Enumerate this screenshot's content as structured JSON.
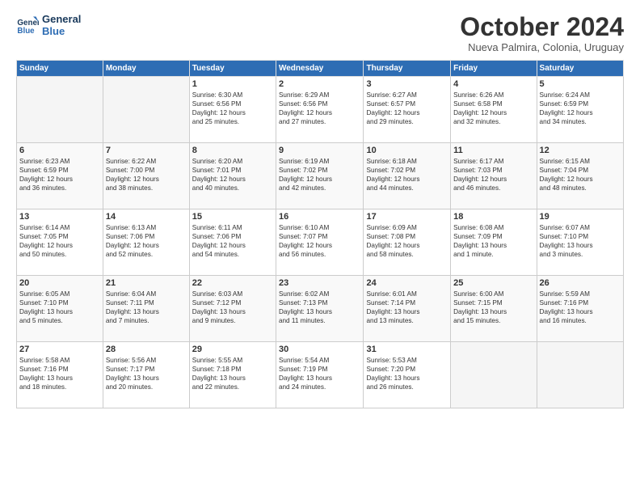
{
  "logo": {
    "line1": "General",
    "line2": "Blue"
  },
  "title": "October 2024",
  "subtitle": "Nueva Palmira, Colonia, Uruguay",
  "days_header": [
    "Sunday",
    "Monday",
    "Tuesday",
    "Wednesday",
    "Thursday",
    "Friday",
    "Saturday"
  ],
  "weeks": [
    [
      {
        "day": "",
        "info": ""
      },
      {
        "day": "",
        "info": ""
      },
      {
        "day": "1",
        "info": "Sunrise: 6:30 AM\nSunset: 6:56 PM\nDaylight: 12 hours\nand 25 minutes."
      },
      {
        "day": "2",
        "info": "Sunrise: 6:29 AM\nSunset: 6:56 PM\nDaylight: 12 hours\nand 27 minutes."
      },
      {
        "day": "3",
        "info": "Sunrise: 6:27 AM\nSunset: 6:57 PM\nDaylight: 12 hours\nand 29 minutes."
      },
      {
        "day": "4",
        "info": "Sunrise: 6:26 AM\nSunset: 6:58 PM\nDaylight: 12 hours\nand 32 minutes."
      },
      {
        "day": "5",
        "info": "Sunrise: 6:24 AM\nSunset: 6:59 PM\nDaylight: 12 hours\nand 34 minutes."
      }
    ],
    [
      {
        "day": "6",
        "info": "Sunrise: 6:23 AM\nSunset: 6:59 PM\nDaylight: 12 hours\nand 36 minutes."
      },
      {
        "day": "7",
        "info": "Sunrise: 6:22 AM\nSunset: 7:00 PM\nDaylight: 12 hours\nand 38 minutes."
      },
      {
        "day": "8",
        "info": "Sunrise: 6:20 AM\nSunset: 7:01 PM\nDaylight: 12 hours\nand 40 minutes."
      },
      {
        "day": "9",
        "info": "Sunrise: 6:19 AM\nSunset: 7:02 PM\nDaylight: 12 hours\nand 42 minutes."
      },
      {
        "day": "10",
        "info": "Sunrise: 6:18 AM\nSunset: 7:02 PM\nDaylight: 12 hours\nand 44 minutes."
      },
      {
        "day": "11",
        "info": "Sunrise: 6:17 AM\nSunset: 7:03 PM\nDaylight: 12 hours\nand 46 minutes."
      },
      {
        "day": "12",
        "info": "Sunrise: 6:15 AM\nSunset: 7:04 PM\nDaylight: 12 hours\nand 48 minutes."
      }
    ],
    [
      {
        "day": "13",
        "info": "Sunrise: 6:14 AM\nSunset: 7:05 PM\nDaylight: 12 hours\nand 50 minutes."
      },
      {
        "day": "14",
        "info": "Sunrise: 6:13 AM\nSunset: 7:06 PM\nDaylight: 12 hours\nand 52 minutes."
      },
      {
        "day": "15",
        "info": "Sunrise: 6:11 AM\nSunset: 7:06 PM\nDaylight: 12 hours\nand 54 minutes."
      },
      {
        "day": "16",
        "info": "Sunrise: 6:10 AM\nSunset: 7:07 PM\nDaylight: 12 hours\nand 56 minutes."
      },
      {
        "day": "17",
        "info": "Sunrise: 6:09 AM\nSunset: 7:08 PM\nDaylight: 12 hours\nand 58 minutes."
      },
      {
        "day": "18",
        "info": "Sunrise: 6:08 AM\nSunset: 7:09 PM\nDaylight: 13 hours\nand 1 minute."
      },
      {
        "day": "19",
        "info": "Sunrise: 6:07 AM\nSunset: 7:10 PM\nDaylight: 13 hours\nand 3 minutes."
      }
    ],
    [
      {
        "day": "20",
        "info": "Sunrise: 6:05 AM\nSunset: 7:10 PM\nDaylight: 13 hours\nand 5 minutes."
      },
      {
        "day": "21",
        "info": "Sunrise: 6:04 AM\nSunset: 7:11 PM\nDaylight: 13 hours\nand 7 minutes."
      },
      {
        "day": "22",
        "info": "Sunrise: 6:03 AM\nSunset: 7:12 PM\nDaylight: 13 hours\nand 9 minutes."
      },
      {
        "day": "23",
        "info": "Sunrise: 6:02 AM\nSunset: 7:13 PM\nDaylight: 13 hours\nand 11 minutes."
      },
      {
        "day": "24",
        "info": "Sunrise: 6:01 AM\nSunset: 7:14 PM\nDaylight: 13 hours\nand 13 minutes."
      },
      {
        "day": "25",
        "info": "Sunrise: 6:00 AM\nSunset: 7:15 PM\nDaylight: 13 hours\nand 15 minutes."
      },
      {
        "day": "26",
        "info": "Sunrise: 5:59 AM\nSunset: 7:16 PM\nDaylight: 13 hours\nand 16 minutes."
      }
    ],
    [
      {
        "day": "27",
        "info": "Sunrise: 5:58 AM\nSunset: 7:16 PM\nDaylight: 13 hours\nand 18 minutes."
      },
      {
        "day": "28",
        "info": "Sunrise: 5:56 AM\nSunset: 7:17 PM\nDaylight: 13 hours\nand 20 minutes."
      },
      {
        "day": "29",
        "info": "Sunrise: 5:55 AM\nSunset: 7:18 PM\nDaylight: 13 hours\nand 22 minutes."
      },
      {
        "day": "30",
        "info": "Sunrise: 5:54 AM\nSunset: 7:19 PM\nDaylight: 13 hours\nand 24 minutes."
      },
      {
        "day": "31",
        "info": "Sunrise: 5:53 AM\nSunset: 7:20 PM\nDaylight: 13 hours\nand 26 minutes."
      },
      {
        "day": "",
        "info": ""
      },
      {
        "day": "",
        "info": ""
      }
    ]
  ]
}
